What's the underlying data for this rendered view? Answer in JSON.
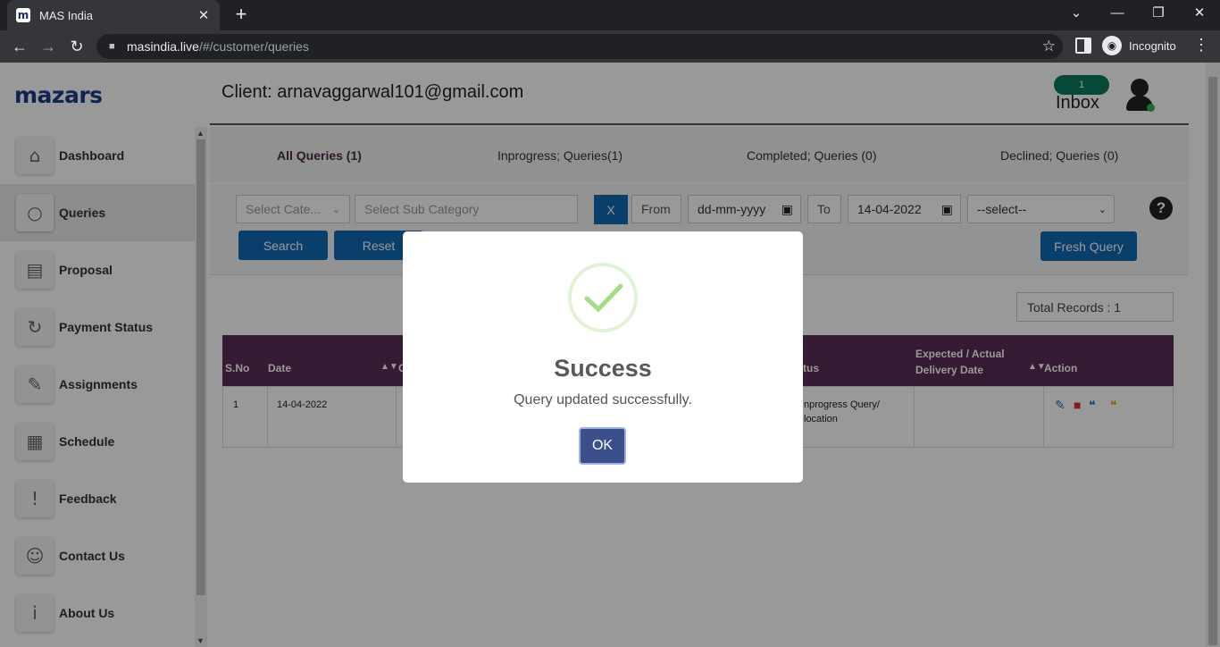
{
  "browser": {
    "tab_title": "MAS India",
    "tab_favicon": "m",
    "url_host": "masindia.live",
    "url_path": "/#/customer/queries",
    "profile_label": "Incognito"
  },
  "sidebar": {
    "logo": "mazars",
    "items": [
      {
        "label": "Dashboard",
        "icon": "home-icon",
        "glyph": "⌂"
      },
      {
        "label": "Queries",
        "icon": "search-icon",
        "glyph": "○"
      },
      {
        "label": "Proposal",
        "icon": "proposal-icon",
        "glyph": "▤"
      },
      {
        "label": "Payment Status",
        "icon": "payment-icon",
        "glyph": "↻"
      },
      {
        "label": "Assignments",
        "icon": "assignments-icon",
        "glyph": "✎"
      },
      {
        "label": "Schedule",
        "icon": "calendar-icon",
        "glyph": "▦"
      },
      {
        "label": "Feedback",
        "icon": "feedback-icon",
        "glyph": "!"
      },
      {
        "label": "Contact Us",
        "icon": "contact-icon",
        "glyph": "☺"
      },
      {
        "label": "About Us",
        "icon": "info-icon",
        "glyph": "i"
      }
    ],
    "active_index": 1
  },
  "header": {
    "client": "Client: arnavaggarwal101@gmail.com",
    "inbox_count": "1",
    "inbox_label": "Inbox"
  },
  "tabs": [
    {
      "label": "All Queries (1)"
    },
    {
      "label": "Inprogress; Queries(1)"
    },
    {
      "label": "Completed; Queries (0)"
    },
    {
      "label": "Declined; Queries (0)"
    }
  ],
  "filters": {
    "category_placeholder": "Select Cate...",
    "subcategory_placeholder": "Select Sub Category",
    "clear_label": "X",
    "from_label": "From",
    "from_value": "dd-mm-yyyy",
    "to_label": "To",
    "to_value": "14-04-2022",
    "status_select": "--select--",
    "search_label": "Search",
    "reset_label": "Reset",
    "fresh_query_label": "Fresh Query"
  },
  "total_records": "Total Records : 1",
  "table": {
    "headers": {
      "sno": "S.No",
      "date": "Date",
      "c": "C",
      "status": "tus",
      "delivery": "Expected / Actual Delivery Date",
      "action": "Action"
    },
    "rows": [
      {
        "sno": "1",
        "date": "14-04-2022",
        "status_line1": "nprogress Query/",
        "status_line2": "location",
        "delivery": ""
      }
    ]
  },
  "modal": {
    "title": "Success",
    "message": "Query updated successfully.",
    "ok_label": "OK"
  },
  "colors": {
    "accent_purple": "#5a2a55",
    "button_blue": "#1268b3",
    "success_green": "#a5dc86",
    "ok_button": "#3b4f8c"
  }
}
